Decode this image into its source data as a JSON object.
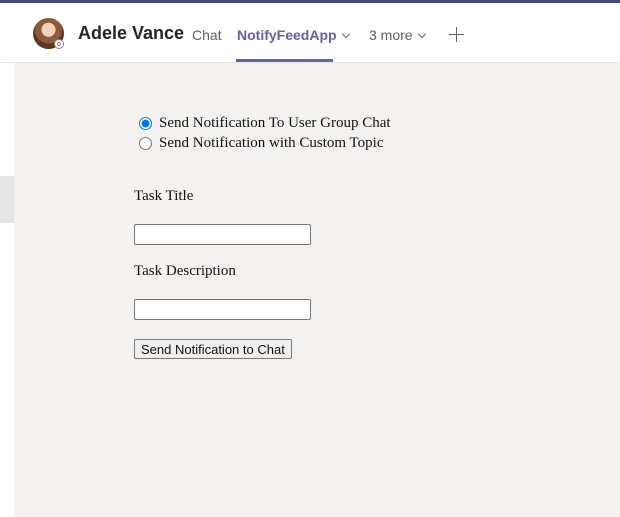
{
  "header": {
    "user_name": "Adele Vance",
    "tabs": [
      {
        "label": "Chat",
        "active": false
      },
      {
        "label": "NotifyFeedApp",
        "active": true
      },
      {
        "label": "3 more",
        "active": false
      }
    ]
  },
  "colors": {
    "accent": "#6264a7",
    "top_stripe": "#464775",
    "content_background": "#f3f2f1"
  },
  "icons": {
    "avatar": "user-avatar",
    "status": "status-offline-icon",
    "add_tab": "plus-icon",
    "dropdown": "chevron-down-icon"
  },
  "form": {
    "radio_options": [
      {
        "label": "Send Notification To User Group Chat",
        "checked": true
      },
      {
        "label": "Send Notification with Custom Topic",
        "checked": false
      }
    ],
    "task_title_label": "Task Title",
    "task_title_value": "",
    "task_description_label": "Task Description",
    "task_description_value": "",
    "submit_label": "Send Notification to Chat"
  }
}
